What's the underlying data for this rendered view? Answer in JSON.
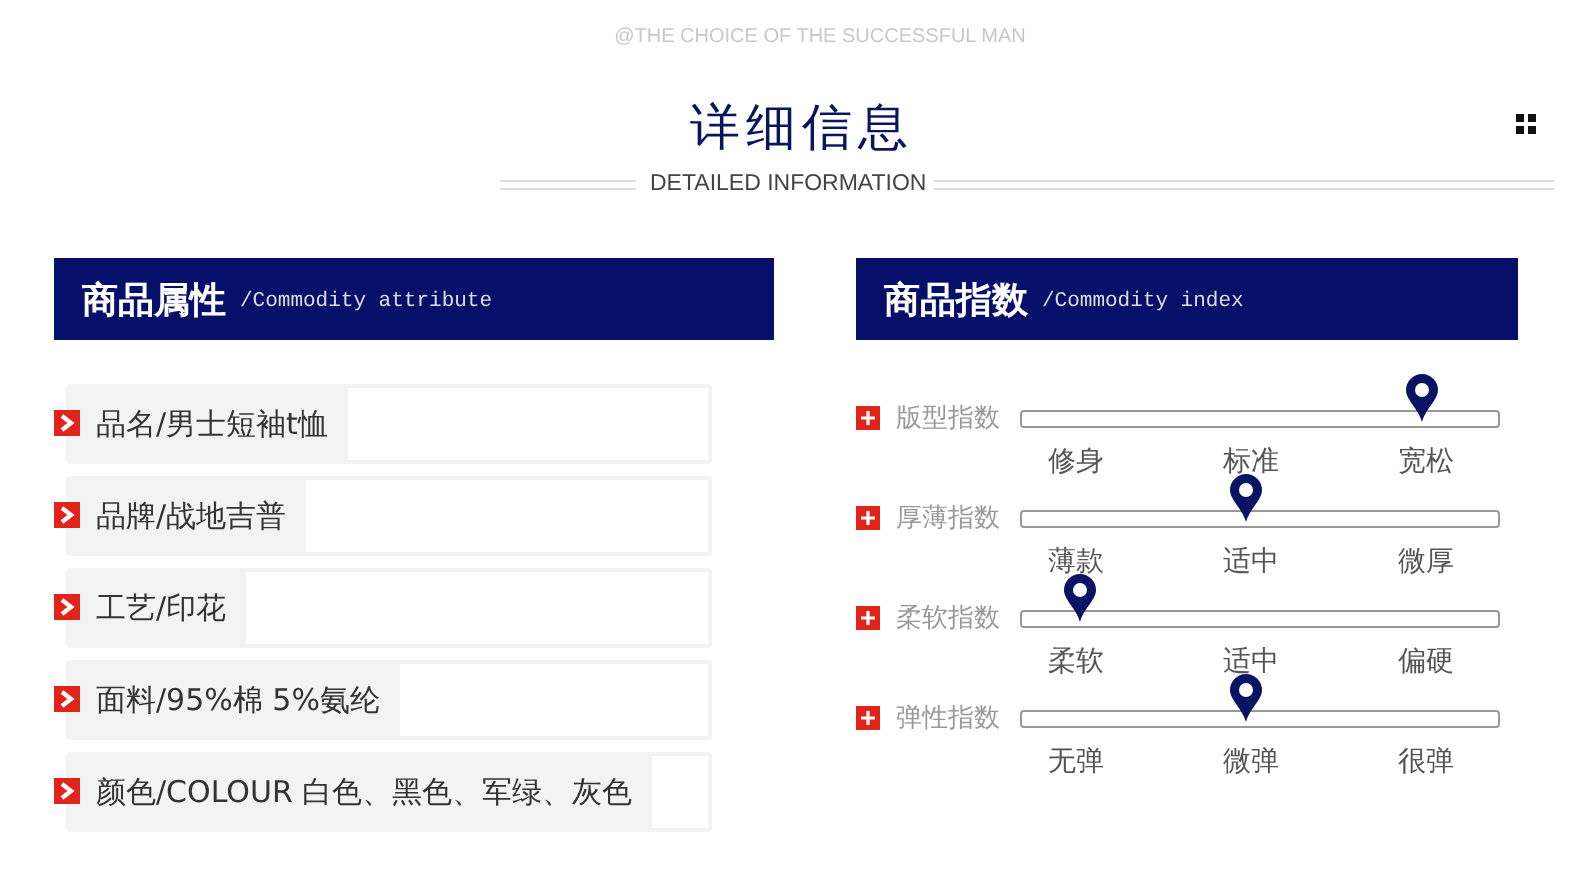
{
  "tagline": "@THE CHOICE OF THE SUCCESSFUL MAN",
  "title": "详细信息",
  "subtitle": "DETAILED INFORMATION",
  "attributes_panel": {
    "title": "商品属性",
    "subtitle": "/Commodity attribute",
    "items": [
      "品名/男士短袖t恤",
      "品牌/战地吉普",
      "工艺/印花",
      "面料/95%棉 5%氨纶",
      "颜色/COLOUR 白色、黑色、军绿、灰色"
    ]
  },
  "index_panel": {
    "title": "商品指数",
    "subtitle": "/Commodity index",
    "scales": [
      {
        "label": "版型指数",
        "level": 0.84,
        "options": [
          "修身",
          "标准",
          "宽松"
        ]
      },
      {
        "label": "厚薄指数",
        "level": 0.47,
        "options": [
          "薄款",
          "适中",
          "微厚"
        ]
      },
      {
        "label": "柔软指数",
        "level": 0.12,
        "options": [
          "柔软",
          "适中",
          "偏硬"
        ]
      },
      {
        "label": "弹性指数",
        "level": 0.47,
        "options": [
          "无弹",
          "微弹",
          "很弹"
        ]
      }
    ]
  }
}
